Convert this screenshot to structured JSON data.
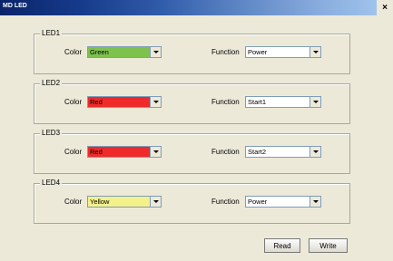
{
  "window": {
    "title": "MD LED",
    "close_glyph": "×"
  },
  "groups": [
    {
      "name": "LED1",
      "color_label": "Color",
      "color_value": "Green",
      "color_swatch": "#7ec24e",
      "function_label": "Function",
      "function_value": "Power"
    },
    {
      "name": "LED2",
      "color_label": "Color",
      "color_value": "Red",
      "color_swatch": "#ee2a2a",
      "function_label": "Function",
      "function_value": "Start1"
    },
    {
      "name": "LED3",
      "color_label": "Color",
      "color_value": "Red",
      "color_swatch": "#ee2a2a",
      "function_label": "Function",
      "function_value": "Start2"
    },
    {
      "name": "LED4",
      "color_label": "Color",
      "color_value": "Yellow",
      "color_swatch": "#f4f08a",
      "function_label": "Function",
      "function_value": "Power"
    }
  ],
  "buttons": {
    "read_label": "Read",
    "write_label": "Write"
  }
}
